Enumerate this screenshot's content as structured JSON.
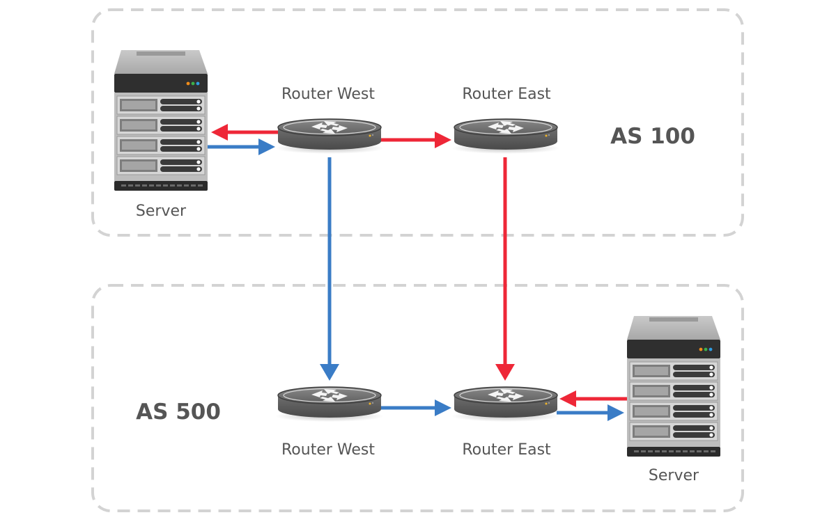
{
  "diagram": {
    "groups": [
      {
        "id": "as100",
        "label": "AS 100"
      },
      {
        "id": "as500",
        "label": "AS 500"
      }
    ],
    "nodes": [
      {
        "id": "server-top",
        "type": "server",
        "label": "Server",
        "group": "as100"
      },
      {
        "id": "rw-top",
        "type": "router",
        "label": "Router West",
        "group": "as100"
      },
      {
        "id": "re-top",
        "type": "router",
        "label": "Router East",
        "group": "as100"
      },
      {
        "id": "rw-bot",
        "type": "router",
        "label": "Router West",
        "group": "as500"
      },
      {
        "id": "re-bot",
        "type": "router",
        "label": "Router East",
        "group": "as500"
      },
      {
        "id": "server-bot",
        "type": "server",
        "label": "Server",
        "group": "as500"
      }
    ],
    "edges": [
      {
        "from": "rw-top",
        "to": "server-top",
        "color": "red"
      },
      {
        "from": "server-top",
        "to": "rw-top",
        "color": "blue"
      },
      {
        "from": "rw-top",
        "to": "re-top",
        "color": "red"
      },
      {
        "from": "rw-top",
        "to": "rw-bot",
        "color": "blue"
      },
      {
        "from": "re-top",
        "to": "re-bot",
        "color": "red"
      },
      {
        "from": "rw-bot",
        "to": "re-bot",
        "color": "blue"
      },
      {
        "from": "server-bot",
        "to": "re-bot",
        "color": "red"
      },
      {
        "from": "re-bot",
        "to": "server-bot",
        "color": "blue"
      }
    ],
    "colors": {
      "red": "#ee2737",
      "blue": "#3a7cc6",
      "border": "#d3d3d3",
      "text": "#555555"
    }
  }
}
